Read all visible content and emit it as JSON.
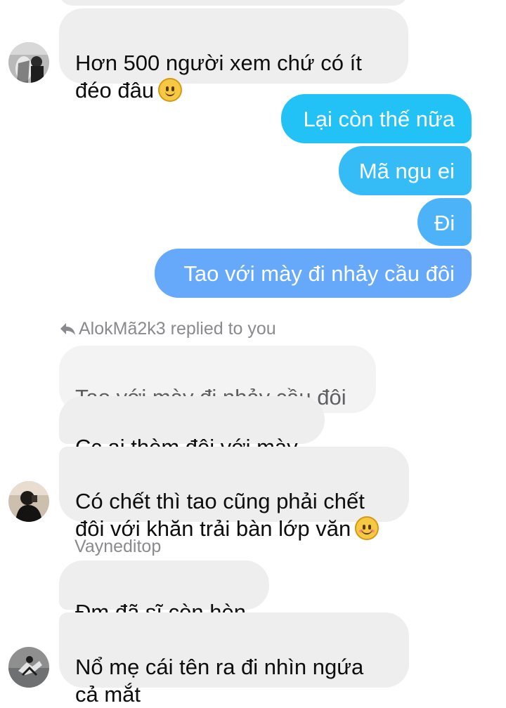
{
  "colors": {
    "incoming_bubble": "#eeeeef",
    "outgoing_gradient_top": "#22c2f6",
    "outgoing_gradient_bottom": "#6aa7fa"
  },
  "messages": {
    "m1_text": "Hơn 500 người xem chứ có ít\nđéo đâu",
    "m1_emoji": "slightly-smiling-face",
    "out1": "Lại còn thế nữa",
    "out2": "Mã ngu ei",
    "out3": "Đi",
    "out4": "Tao với mày đi nhảy cầu đôi",
    "reply_header": "AlokMã2k3 replied to you",
    "quoted": "Tao với mày đi nhảy cầu đôi",
    "r1": "Cc ai thèm đôi với mày",
    "r2_text": "Có chết thì tao cũng phải chết\nđôi với khăn trải bàn lớp văn",
    "r2_emoji": "smiling-face-with-smiling-eyes",
    "sender2": "Vayneditop",
    "v1": "Đm đã sĩ còn hèn",
    "v2": "Nổ mẹ cái tên ra đi nhìn ngứa\ncả mắt"
  }
}
